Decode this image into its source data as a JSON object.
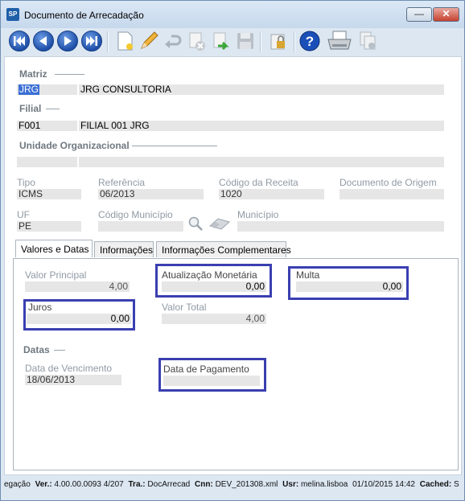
{
  "window": {
    "title": "Documento de Arrecadação",
    "app_icon": "SP"
  },
  "toolbar": {
    "buttons": [
      "first-record-icon",
      "previous-record-icon",
      "next-record-icon",
      "last-record-icon",
      "new-document-icon",
      "edit-pencil-icon",
      "undo-icon",
      "delete-icon",
      "confirm-icon",
      "save-icon",
      "lock-icon",
      "help-icon",
      "print-icon",
      "copy-icon"
    ],
    "colors": {
      "nav": "#1e4fa8",
      "help": "#1b4fb8"
    }
  },
  "matriz": {
    "section": "Matriz",
    "code": "JRG",
    "name": "JRG CONSULTORIA"
  },
  "filial": {
    "section": "Filial",
    "code": "F001",
    "name": "FILIAL 001 JRG"
  },
  "unidade": {
    "section": "Unidade Organizacional",
    "code": "",
    "name": ""
  },
  "fields": {
    "tipo_label": "Tipo",
    "tipo": "ICMS",
    "referencia_label": "Referência",
    "referencia": "06/2013",
    "codigo_receita_label": "Código da Receita",
    "codigo_receita": "1020",
    "documento_origem_label": "Documento de Origem",
    "documento_origem": "",
    "uf_label": "UF",
    "uf": "PE",
    "codigo_municipio_label": "Código Município",
    "codigo_municipio": "",
    "municipio_label": "Município",
    "municipio": ""
  },
  "tabs": [
    {
      "label": "Valores e Datas",
      "active": true
    },
    {
      "label": "Informações",
      "active": false
    },
    {
      "label": "Informações Complementares",
      "active": false
    }
  ],
  "valores": {
    "valor_principal_label": "Valor Principal",
    "valor_principal": "4,00",
    "atualizacao_label": "Atualização Monetária",
    "atualizacao": "0,00",
    "multa_label": "Multa",
    "multa": "0,00",
    "juros_label": "Juros",
    "juros": "0,00",
    "valor_total_label": "Valor Total",
    "valor_total": "4,00"
  },
  "datas": {
    "section": "Datas",
    "vencimento_label": "Data de Vencimento",
    "vencimento": "18/06/2013",
    "pagamento_label": "Data de Pagamento",
    "pagamento": ""
  },
  "statusbar": {
    "nav": "egação",
    "ver_label": "Ver.:",
    "ver": "4.00.00.0093",
    "build": "4/207",
    "tra_label": "Tra.:",
    "tra": "DocArrecad",
    "cnn_label": "Cnn:",
    "cnn": "DEV_201308.xml",
    "usr_label": "Usr:",
    "usr": "melina.lisboa",
    "datetime": "01/10/2015 14:42",
    "cached_label": "Cached:",
    "cached": "S"
  },
  "highlight_color": "#3a3fb0"
}
